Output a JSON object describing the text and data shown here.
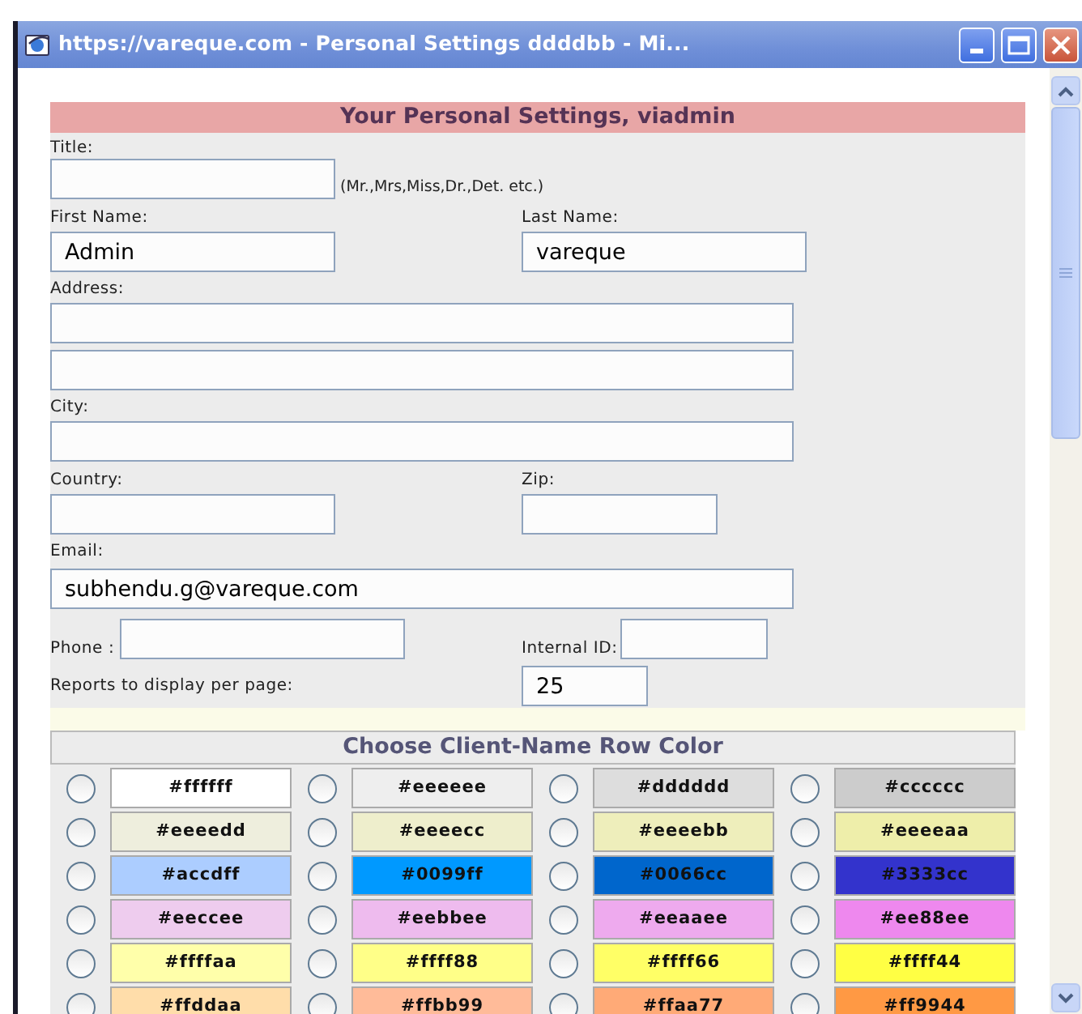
{
  "window": {
    "title": "https://vareque.com - Personal Settings ddddbb - Mi..."
  },
  "form": {
    "heading": "Your Personal Settings, viadmin",
    "title": {
      "label": "Title:",
      "hint": "(Mr.,Mrs,Miss,Dr.,Det. etc.)"
    },
    "first_name": {
      "label": "First Name:",
      "value": "Admin"
    },
    "last_name": {
      "label": "Last Name:",
      "value": "vareque"
    },
    "address": {
      "label": "Address:"
    },
    "city": {
      "label": "City:"
    },
    "country": {
      "label": "Country:"
    },
    "zip": {
      "label": "Zip:"
    },
    "email": {
      "label": "Email:",
      "value": "subhendu.g@vareque.com"
    },
    "phone": {
      "label": "Phone :"
    },
    "internal_id": {
      "label": "Internal ID:"
    },
    "reports_per_page": {
      "label": "Reports to display per page:",
      "value": "25"
    }
  },
  "row_color": {
    "heading": "Choose Client-Name Row Color",
    "swatches": [
      {
        "label": "#ffffff",
        "color": "#ffffff",
        "selected": false
      },
      {
        "label": "#eeeeee",
        "color": "#eeeeee",
        "selected": false
      },
      {
        "label": "#dddddd",
        "color": "#dddddd",
        "selected": false
      },
      {
        "label": "#cccccc",
        "color": "#cccccc",
        "selected": false
      },
      {
        "label": "#eeeedd",
        "color": "#eeeedd",
        "selected": false
      },
      {
        "label": "#eeeecc",
        "color": "#eeeecc",
        "selected": false
      },
      {
        "label": "#eeeebb",
        "color": "#eeeebb",
        "selected": false
      },
      {
        "label": "#eeeeaa",
        "color": "#eeeeaa",
        "selected": false
      },
      {
        "label": "#accdff",
        "color": "#accdff",
        "selected": false
      },
      {
        "label": "#0099ff",
        "color": "#0099ff",
        "selected": false
      },
      {
        "label": "#0066cc",
        "color": "#0066cc",
        "selected": false
      },
      {
        "label": "#3333cc",
        "color": "#3333cc",
        "selected": false
      },
      {
        "label": "#eeccee",
        "color": "#eeccee",
        "selected": false
      },
      {
        "label": "#eebbee",
        "color": "#eebbee",
        "selected": false
      },
      {
        "label": "#eeaaee",
        "color": "#eeaaee",
        "selected": false
      },
      {
        "label": "#ee88ee",
        "color": "#ee88ee",
        "selected": false
      },
      {
        "label": "#ffffaa",
        "color": "#ffffaa",
        "selected": false
      },
      {
        "label": "#ffff88",
        "color": "#ffff88",
        "selected": false
      },
      {
        "label": "#ffff66",
        "color": "#ffff66",
        "selected": false
      },
      {
        "label": "#ffff44",
        "color": "#ffff44",
        "selected": false
      },
      {
        "label": "#ffddaa",
        "color": "#ffddaa",
        "selected": false
      },
      {
        "label": "#ffbb99",
        "color": "#ffbb99",
        "selected": false
      },
      {
        "label": "#ffaa77",
        "color": "#ffaa77",
        "selected": false
      },
      {
        "label": "#ff9944",
        "color": "#ff9944",
        "selected": false
      }
    ]
  }
}
